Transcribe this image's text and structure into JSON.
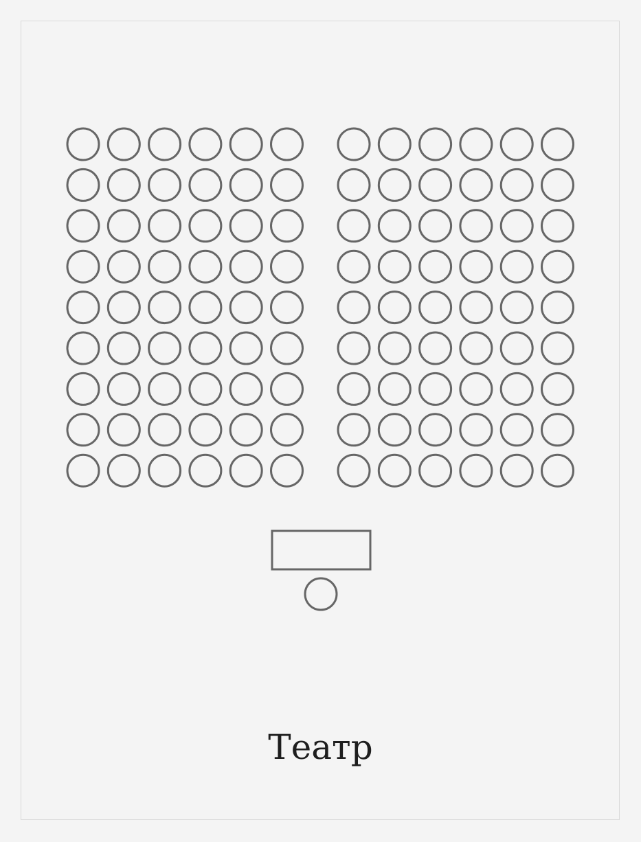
{
  "layout": {
    "name": "Театр",
    "rows": 9,
    "seats_per_block": 6,
    "blocks": 2
  },
  "colors": {
    "background": "#f4f4f4",
    "stroke": "#666666",
    "frame": "#d9d9d9",
    "text": "#1e1e1e"
  },
  "icons": {
    "seat": "circle-seat",
    "table": "rectangle-table",
    "speaker": "circle-seat"
  }
}
